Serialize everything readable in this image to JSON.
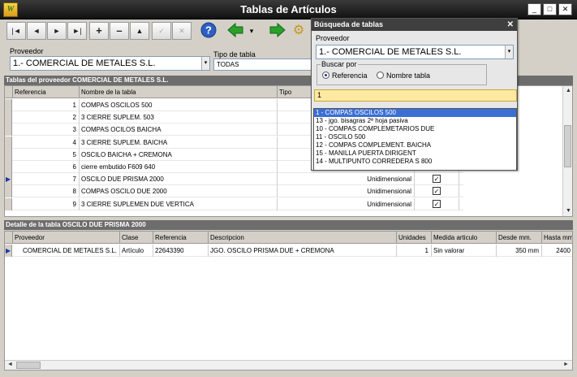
{
  "window": {
    "app_icon_letter": "W",
    "title": "Tablas de Artículos",
    "minimize_glyph": "_",
    "maximize_glyph": "□",
    "close_glyph": "✕"
  },
  "toolbar": {
    "first_glyph": "|◄",
    "prev_glyph": "◄",
    "next_glyph": "►",
    "last_glyph": "►|",
    "add_glyph": "+",
    "remove_glyph": "–",
    "up_glyph": "▲",
    "confirm_glyph": "✓",
    "cancel_glyph": "✕",
    "help_glyph": "?",
    "back_glyph": "◀",
    "dropdown_glyph": "▾",
    "forward_glyph": "▶",
    "tools_glyph": "⚙"
  },
  "filters": {
    "proveedor_label": "Proveedor",
    "proveedor_value": "1.- COMERCIAL DE METALES S.L.",
    "tipo_label": "Tipo de tabla",
    "tipo_value": "TODAS"
  },
  "tables_section": {
    "title": "Tablas del proveedor COMERCIAL DE METALES S.L.",
    "columns": [
      "Referencia",
      "Nombre de la tabla",
      "Tipo"
    ],
    "rows": [
      {
        "ref": "1",
        "name": "COMPAS OSCILOS 500",
        "tipo": "",
        "checked": ""
      },
      {
        "ref": "2",
        "name": "3 CIERRE SUPLEM. 503",
        "tipo": "",
        "checked": ""
      },
      {
        "ref": "3",
        "name": "COMPAS OCILOS BAICHA",
        "tipo": "",
        "checked": ""
      },
      {
        "ref": "4",
        "name": "3 CIERRE SUPLEM. BAICHA",
        "tipo": "",
        "checked": ""
      },
      {
        "ref": "5",
        "name": "OSCILO BAICHA + CREMONA",
        "tipo": "",
        "checked": ""
      },
      {
        "ref": "6",
        "name": "cierre embutido F609 640",
        "tipo": "",
        "checked": ""
      },
      {
        "ref": "7",
        "name": "OSCILO DUE PRISMA 2000",
        "tipo": "Unidimensional",
        "checked": "✓"
      },
      {
        "ref": "8",
        "name": "COMPAS OSCILO DUE 2000",
        "tipo": "Unidimensional",
        "checked": "✓"
      },
      {
        "ref": "9",
        "name": "3 CIERRE SUPLEMEN DUE VERTICA",
        "tipo": "Unidimensional",
        "checked": "✓"
      }
    ],
    "current_row_marker": "▶"
  },
  "detail_section": {
    "title": "Detalle de la tabla OSCILO DUE PRISMA 2000",
    "columns": [
      "Proveedor",
      "Clase",
      "Referencia",
      "Descripcion",
      "Unidades",
      "Medida articulo",
      "Desde mm.",
      "Hasta mm"
    ],
    "rows": [
      {
        "proveedor": "COMERCIAL DE METALES S.L.",
        "clase": "Artículo",
        "referencia": "22643390",
        "descripcion": "JGO. OSCILO PRISMA DUE + CREMONA",
        "unidades": "1",
        "medida": "Sin valorar",
        "desde": "350 mm",
        "hasta": "2400"
      }
    ]
  },
  "search_dialog": {
    "title": "Búsqueda de tablas",
    "close_glyph": "✕",
    "proveedor_label": "Proveedor",
    "proveedor_value": "1.- COMERCIAL DE METALES S.L.",
    "buscar_por_label": "Buscar por",
    "option_referencia": "Referencia",
    "option_nombre": "Nombre tabla",
    "selected_option": "Referencia",
    "search_value": "1",
    "results": [
      "1 - COMPAS OSCILOS 500",
      "13 - jgo. bisagras 2ª hoja pasiva",
      "10 - COMPAS COMPLEMETARIOS DUE",
      "11 - OSCILO 500",
      "12 - COMPAS COMPLEMENT. BAICHA",
      "15 - MANILLA PUERTA DIRIGENT",
      "14 - MULTIPUNTO CORREDERA S 800"
    ],
    "selected_result_index": 0
  },
  "colors": {
    "titlebar": "#1a1a1a",
    "section_header": "#6d6d6d",
    "search_field": "#fde9a0",
    "selection": "#3b6fd4",
    "help_blue": "#2d5fc2",
    "nav_green": "#2aa02a"
  }
}
